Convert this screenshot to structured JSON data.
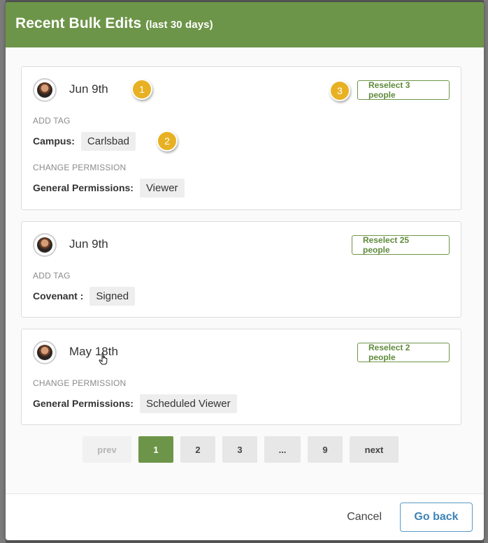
{
  "modal": {
    "title": "Recent Bulk Edits",
    "subtitle": "(last 30 days)"
  },
  "edits": [
    {
      "date": "Jun 9th",
      "reselect_label": "Reselect 3 people",
      "sections": [
        {
          "label": "ADD TAG",
          "field": "Campus:",
          "value": "Carlsbad"
        },
        {
          "label": "CHANGE PERMISSION",
          "field": "General Permissions:",
          "value": "Viewer"
        }
      ]
    },
    {
      "date": "Jun 9th",
      "reselect_label": "Reselect 25 people",
      "sections": [
        {
          "label": "ADD TAG",
          "field": "Covenant :",
          "value": "Signed"
        }
      ]
    },
    {
      "date": "May 18th",
      "reselect_label": "Reselect 2 people",
      "sections": [
        {
          "label": "CHANGE PERMISSION",
          "field": "General Permissions:",
          "value": "Scheduled Viewer"
        }
      ]
    }
  ],
  "callouts": [
    "1",
    "2",
    "3"
  ],
  "pagination": {
    "prev": "prev",
    "pages": [
      "1",
      "2",
      "3",
      "...",
      "9"
    ],
    "current": "1",
    "next": "next"
  },
  "footer": {
    "cancel": "Cancel",
    "go_back": "Go back"
  },
  "colors": {
    "brand_green": "#6d9549",
    "callout_yellow": "#e8b123",
    "link_blue": "#3d83b6"
  },
  "icons": {
    "avatar": "user-avatar",
    "cursor": "hand-pointer-icon"
  }
}
